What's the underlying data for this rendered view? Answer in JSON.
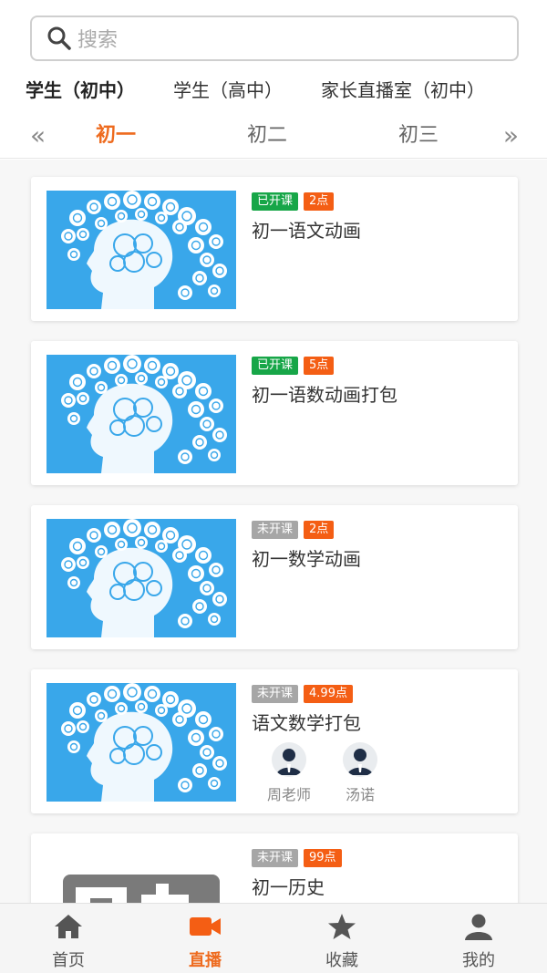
{
  "search": {
    "placeholder": "搜索"
  },
  "categories": [
    {
      "label": "学生（初中）",
      "active": true
    },
    {
      "label": "学生（高中）",
      "active": false
    },
    {
      "label": "家长直播室（初中）",
      "active": false
    }
  ],
  "grades": {
    "prev": "«",
    "next": "»",
    "items": [
      {
        "label": "初一",
        "active": true
      },
      {
        "label": "初二",
        "active": false
      },
      {
        "label": "初三",
        "active": false
      }
    ]
  },
  "courses": [
    {
      "status": "已开课",
      "points": "2点",
      "title": "初一语文动画",
      "image": "brain-illustration"
    },
    {
      "status": "已开课",
      "points": "5点",
      "title": "初一语数动画打包",
      "image": "brain-illustration"
    },
    {
      "status": "未开课",
      "points": "2点",
      "title": "初一数学动画",
      "image": "brain-illustration"
    },
    {
      "status": "未开课",
      "points": "4.99点",
      "title": "语文数学打包",
      "image": "brain-illustration",
      "teachers": [
        {
          "name": "周老师",
          "avatar": "teacher-avatar-icon"
        },
        {
          "name": "汤诺",
          "avatar": "teacher-avatar-icon"
        }
      ]
    },
    {
      "status": "未开课",
      "points": "99点",
      "title": "初一历史",
      "image": "history-title-image"
    }
  ],
  "tabbar": [
    {
      "label": "首页",
      "icon": "home-icon",
      "active": false
    },
    {
      "label": "直播",
      "icon": "video-camera-icon",
      "active": true
    },
    {
      "label": "收藏",
      "icon": "star-icon",
      "active": false
    },
    {
      "label": "我的",
      "icon": "person-icon",
      "active": false
    }
  ],
  "colors": {
    "accent": "#ee6b1f",
    "status_open": "#17a648",
    "status_closed": "#a6a6a6",
    "points_badge": "#f45e14",
    "thumb_bg": "#39a7ea"
  }
}
